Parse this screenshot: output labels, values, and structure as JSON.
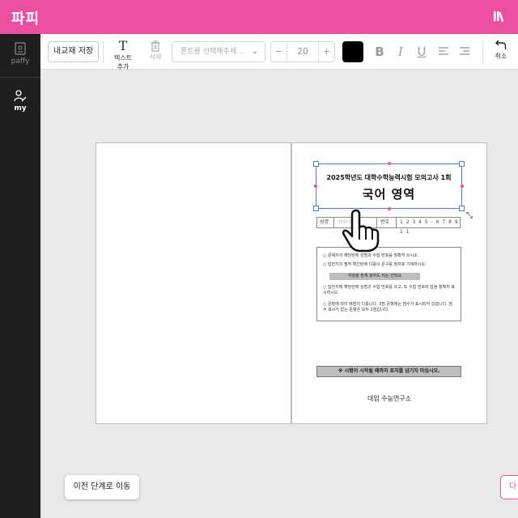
{
  "app": {
    "brand": "파피",
    "colors": {
      "accent": "#ec4fa1",
      "sidebar": "#1f1f1f",
      "selection": "#4a7fd6"
    }
  },
  "sidebar": {
    "items": [
      {
        "label": "paffy",
        "icon": "document-icon"
      },
      {
        "label": "my",
        "icon": "user-edit-icon"
      }
    ]
  },
  "toolbar": {
    "save_label": "내교재 저장",
    "add_text_label": "텍스트 추가",
    "add_text_glyph": "T",
    "delete_label": "삭제",
    "font_placeholder": "폰트를 선택해주세...",
    "font_size": "20",
    "size_minus": "−",
    "size_plus": "+",
    "text_color": "#000000",
    "bold": "B",
    "italic": "I",
    "underline": "U",
    "undo_label": "취소"
  },
  "page_right": {
    "exam_subtitle": "2025학년도 대학수학능력시험 모의고사 1회",
    "exam_title": "국어 영역",
    "name_label": "성명",
    "name_value": "이두나",
    "number_label": "번호",
    "number_value": "1 2 3 4 5 - 6 7 8 9 1 1",
    "notices": [
      "○ 문제지의 해당란에 성명과 수험 번호를 정확히 쓰시오.",
      "○ 답안지의 필적 확인란에 다음의 문구를 정자로 기재하시오.",
      "○ 답안지에 해당란에 성명과 수험 번호를 쓰고, 또 수험 번호와 답을 정확히 표시하시오.",
      "○ 문항에 따라 배점이 다릅니다. 3점 문항에는 점수가 표시되어 있습니다. 점수 표시가 없는 문항은 모두 2점입니다."
    ],
    "notice_band": "걱정을 한게 정하도 되는 선택요",
    "warning": "※ 시험이 시작될 때까지 표지를 넘기지 마십시오.",
    "publisher": "대입 수능연구소"
  },
  "footer": {
    "prev_label": "이전 단계로 이동",
    "next_label": "다"
  }
}
